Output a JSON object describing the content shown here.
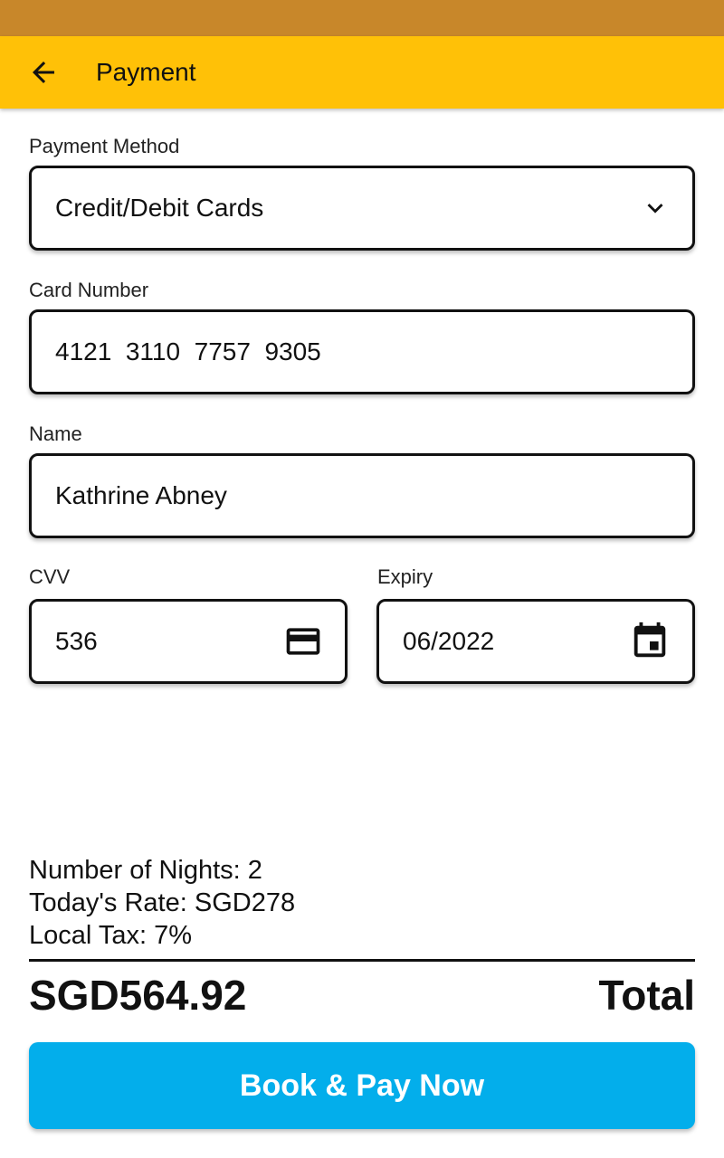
{
  "app_bar": {
    "title": "Payment",
    "back_icon": "arrow-back-icon",
    "color": "#FFC107"
  },
  "status_bar": {
    "color": "#C8872A"
  },
  "form": {
    "payment_method": {
      "label": "Payment Method",
      "value": "Credit/Debit Cards",
      "icon": "chevron-down-icon"
    },
    "card_number": {
      "label": "Card Number",
      "value": "4121  3110  7757  9305"
    },
    "name": {
      "label": "Name",
      "value": "Kathrine Abney"
    },
    "cvv": {
      "label": "CVV",
      "value": "536",
      "icon": "credit-card-icon"
    },
    "expiry": {
      "label": "Expiry",
      "value": "06/2022",
      "icon": "calendar-icon"
    }
  },
  "summary": {
    "nights": "Number of Nights: 2",
    "rate": "Today's Rate: SGD278",
    "tax": "Local Tax: 7%"
  },
  "total": {
    "amount": "SGD564.92",
    "label": "Total"
  },
  "action": {
    "pay_label": "Book & Pay Now",
    "color": "#03AEEB"
  }
}
